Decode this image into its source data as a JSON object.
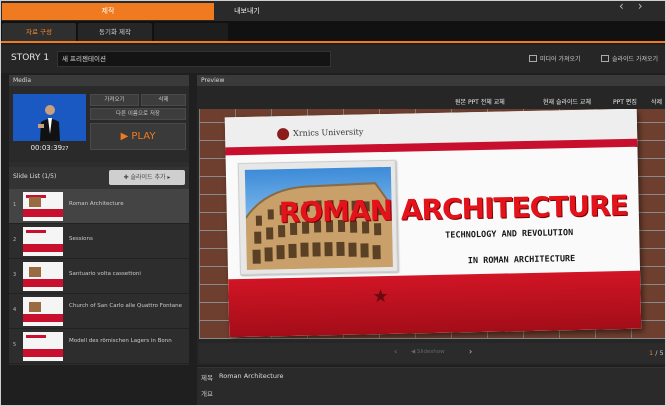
{
  "top_tabs": {
    "make": "제작",
    "export": "내보내기"
  },
  "sub_tabs": {
    "material": "자료 구성",
    "sync": "동기화 제작",
    "other": ""
  },
  "story": {
    "label": "STORY 1",
    "title_value": "새 프리젠테이션",
    "import_media": "미디어 가져오기",
    "import_slides": "슬라이드 가져오기"
  },
  "media": {
    "header": "Media",
    "time": "00:03:39",
    "time_frames": "27",
    "import_label": "가져오기",
    "delete_label": "삭제",
    "save_as_label": "다른 이름으로 저장",
    "play_label": "▶ PLAY"
  },
  "slide_list": {
    "title": "Slide List (1/5)",
    "add_button": "✚ 슬라이드 추가 ▸",
    "items": [
      {
        "num": "1",
        "name": "Roman Architecture"
      },
      {
        "num": "2",
        "name": "Sessions"
      },
      {
        "num": "3",
        "name": "Santuario volta cassettoni"
      },
      {
        "num": "4",
        "name": "Church of San Carlo alle Quattro Fontane"
      },
      {
        "num": "5",
        "name": "Modell des römischen Lagers in Bonn"
      }
    ]
  },
  "preview": {
    "header": "Preview",
    "replace_original": "원본 PPT 전체 교체",
    "replace_current": "현재 슬라이드 교체",
    "ppt_edit": "PPT 편집",
    "delete": "삭제",
    "nav_label": "◀ Slideshow",
    "page_current": "1",
    "page_total": "/ 5",
    "slide": {
      "university": "Xrnics University",
      "title": "ROMAN ARCHITECTURE",
      "subtitle1": "TECHNOLOGY AND REVOLUTION",
      "subtitle2": "IN ROMAN ARCHITECTURE"
    }
  },
  "info": {
    "title_label": "제목",
    "title_value": "Roman Architecture",
    "desc_label": "개요"
  },
  "colors": {
    "accent": "#f07a1f",
    "slide_red": "#c8102e"
  }
}
